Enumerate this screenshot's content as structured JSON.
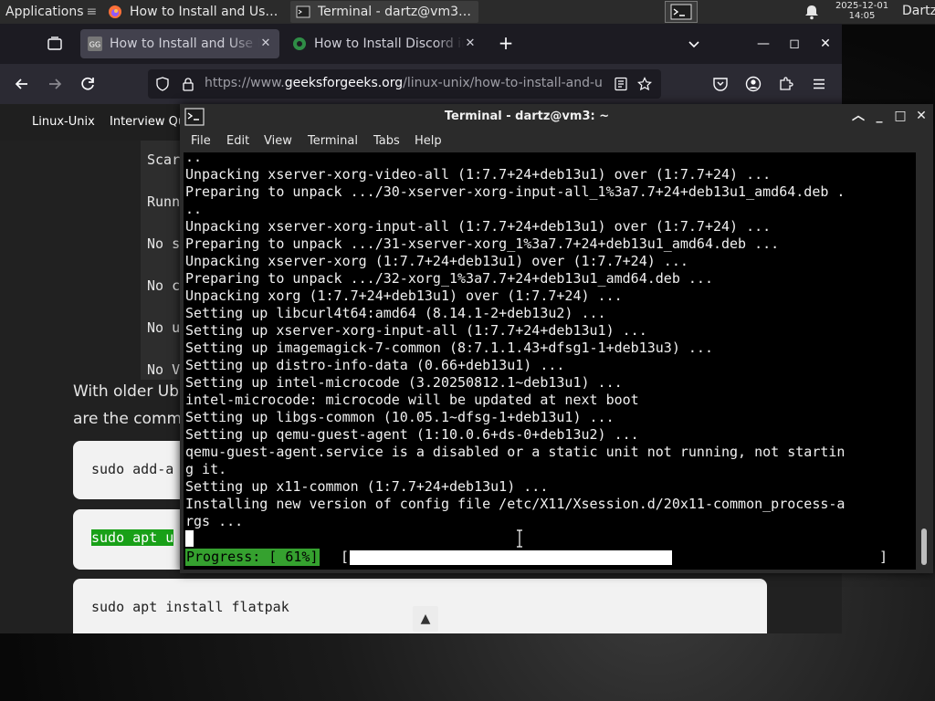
{
  "top_panel": {
    "apps_label": "Applications",
    "task_browser": "How to Install and Use ...",
    "task_terminal": "Terminal - dartz@vm3: ~",
    "clock_date": "2025-12-01",
    "clock_time": "14:05",
    "user": "Dartz"
  },
  "browser": {
    "tabs": [
      {
        "label": "How to Install and Use F",
        "favicon": "geeksforgeeks-icon",
        "active": true
      },
      {
        "label": "How to Install Discord in",
        "favicon": "geeksforgeeks-green-icon",
        "active": false
      }
    ],
    "url_prefix": "https://www.",
    "url_domain": "geeksforgeeks.org",
    "url_path": "/linux-unix/how-to-install-and-u"
  },
  "page": {
    "nav_items": [
      "Linux-Unix",
      "Interview Qu"
    ],
    "output_lines": [
      "Scar",
      "Runn",
      "No s",
      "No c",
      "No u",
      "No V"
    ],
    "text_lines": [
      "With older Ub",
      "are the comma"
    ],
    "code_blocks": [
      "sudo add-a",
      "sudo apt u",
      "sudo apt install flatpak"
    ],
    "scroll_top": "▲"
  },
  "terminal": {
    "title": "Terminal - dartz@vm3: ~",
    "menu": [
      "File",
      "Edit",
      "View",
      "Terminal",
      "Tabs",
      "Help"
    ],
    "lines": [
      "..",
      "Unpacking xserver-xorg-video-all (1:7.7+24+deb13u1) over (1:7.7+24) ...",
      "Preparing to unpack .../30-xserver-xorg-input-all_1%3a7.7+24+deb13u1_amd64.deb .",
      "..",
      "Unpacking xserver-xorg-input-all (1:7.7+24+deb13u1) over (1:7.7+24) ...",
      "Preparing to unpack .../31-xserver-xorg_1%3a7.7+24+deb13u1_amd64.deb ...",
      "Unpacking xserver-xorg (1:7.7+24+deb13u1) over (1:7.7+24) ...",
      "Preparing to unpack .../32-xorg_1%3a7.7+24+deb13u1_amd64.deb ...",
      "Unpacking xorg (1:7.7+24+deb13u1) over (1:7.7+24) ...",
      "Setting up libcurl4t64:amd64 (8.14.1-2+deb13u2) ...",
      "Setting up xserver-xorg-input-all (1:7.7+24+deb13u1) ...",
      "Setting up imagemagick-7-common (8:7.1.1.43+dfsg1-1+deb13u3) ...",
      "Setting up distro-info-data (0.66+deb13u1) ...",
      "Setting up intel-microcode (3.20250812.1~deb13u1) ...",
      "intel-microcode: microcode will be updated at next boot",
      "Setting up libgs-common (10.05.1~dfsg-1+deb13u1) ...",
      "Setting up qemu-guest-agent (1:10.0.6+ds-0+deb13u2) ...",
      "qemu-guest-agent.service is a disabled or a static unit not running, not startin",
      "g it.",
      "Setting up x11-common (1:7.7+24+deb13u1) ...",
      "Installing new version of config file /etc/X11/Xsession.d/20x11-common_process-a",
      "rgs ..."
    ],
    "progress_label": "Progress: [ 61%]",
    "progress_fraction": 0.61,
    "progress_open": "[",
    "progress_close": "]"
  }
}
